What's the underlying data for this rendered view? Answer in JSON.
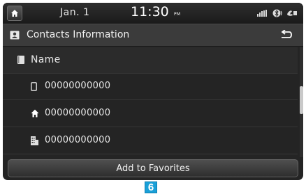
{
  "status_bar": {
    "date": "Jan.  1",
    "time": "11:30",
    "ampm": "PM",
    "icons": [
      "home-icon",
      "signal-icon",
      "bluetooth-icon",
      "phone-battery-icon"
    ]
  },
  "header": {
    "title": "Contacts Information",
    "icon": "contact-card-icon",
    "back_icon": "back-arrow-icon"
  },
  "contact": {
    "name": "Name",
    "numbers": [
      {
        "type": "mobile",
        "icon": "mobile-phone-icon",
        "value": "00000000000"
      },
      {
        "type": "home",
        "icon": "home-phone-icon",
        "value": "00000000000"
      },
      {
        "type": "office",
        "icon": "office-building-icon",
        "value": "00000000000"
      }
    ]
  },
  "actions": {
    "add_to_favorites": "Add to Favorites"
  },
  "callout": {
    "label": "6"
  },
  "colors": {
    "background": "#242424",
    "header": "#3b3b3b",
    "text": "#e6e6e6",
    "callout": "#1aa0d8"
  }
}
